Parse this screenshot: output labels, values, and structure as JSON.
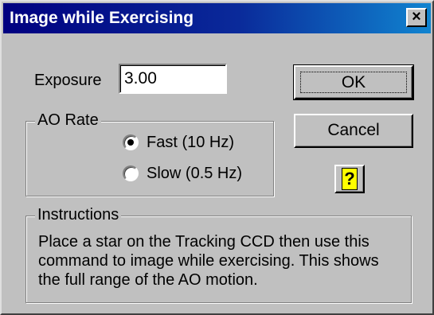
{
  "window": {
    "title": "Image while Exercising",
    "close_label": "×"
  },
  "exposure": {
    "label": "Exposure",
    "value": "3.00"
  },
  "buttons": {
    "ok": "OK",
    "cancel": "Cancel",
    "help": "?"
  },
  "ao_rate": {
    "legend": "AO Rate",
    "options": [
      {
        "label": "Fast (10 Hz)",
        "selected": true
      },
      {
        "label": "Slow (0.5 Hz)",
        "selected": false
      }
    ]
  },
  "instructions": {
    "legend": "Instructions",
    "lines": [
      "Place a star on the Tracking CCD then use this",
      "command to image while exercising.  This shows",
      "the full range of the AO motion."
    ]
  },
  "colors": {
    "titlebar_start": "#000080",
    "titlebar_end": "#1084d0",
    "face": "#c0c0c0",
    "help_icon": "#ffff00"
  }
}
